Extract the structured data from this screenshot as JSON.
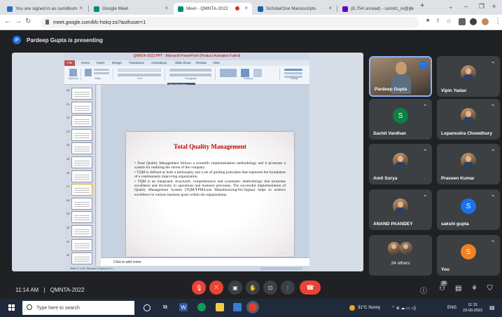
{
  "browser": {
    "tabs": [
      {
        "title": "You are signed in as sumitkum",
        "favicon_color": "#2b6ccd"
      },
      {
        "title": "Google Meet",
        "favicon_color": "#00897b"
      },
      {
        "title": "Meet - QMNTA-2022",
        "favicon_color": "#00897b"
      },
      {
        "title": "ScholarOne Manuscripts",
        "favicon_color": "#1a5fa8"
      },
      {
        "title": "(8,754 unread) - sumit1_in@ya",
        "favicon_color": "#6001d2"
      }
    ],
    "new_tab": "+",
    "close_glyph": "×",
    "address": "meet.google.com/kfc-hokq-zsi?authuser=1"
  },
  "meet": {
    "presenter_initial": "P",
    "presenter_text": "Pardeep Gupta is presenting",
    "meeting_time": "11:14 AM",
    "meeting_code": "QMNTA-2022",
    "separator": "|",
    "participants_badge": "34",
    "participants": [
      {
        "name": "Pardeep Gupta",
        "type": "video"
      },
      {
        "name": "Vipin Yadav",
        "type": "photo"
      },
      {
        "name": "Sachit Vardhan",
        "type": "letter",
        "letter": "S",
        "color": "#0b8043"
      },
      {
        "name": "Lopamudra Chowdhury",
        "type": "photo"
      },
      {
        "name": "Amit Surya",
        "type": "photo"
      },
      {
        "name": "Praveen Kumar",
        "type": "photo"
      },
      {
        "name": "ANAND PAANDEY",
        "type": "photo"
      },
      {
        "name": "sakshi gupta",
        "type": "letter",
        "letter": "S",
        "color": "#1a73e8"
      },
      {
        "name": "24 others",
        "type": "others"
      },
      {
        "name": "You",
        "type": "letter",
        "letter": "S",
        "color": "#f4811f"
      }
    ]
  },
  "ppt": {
    "window_title": "QMNTA-2022.PPT - Microsoft PowerPoint (Product Activation Failed)",
    "ribbon_tabs": [
      "File",
      "Home",
      "Insert",
      "Design",
      "Transitions",
      "Animations",
      "Slide Show",
      "Review",
      "View"
    ],
    "ribbon_groups": [
      "Clipboard",
      "Slides",
      "Font",
      "Paragraph",
      "Drawing",
      "Editing"
    ],
    "tooltip_title": "Start Slide Show",
    "tooltip_text": "Resume Slide Show",
    "slide_title": "Total Quality Management",
    "slide_bullets": [
      "• Total Quality Management follows a scientific implementation methodology and it promotes a system for realizing the vision of the company.",
      "• TQM is defined as both a philosophy and a set of guiding principles that represent the foundation of a continuously improving organization.",
      "• TQM is an integrated, structured, comprehensive and systematic methodology that promotes excellance and diversity in operations and business processes. The successful implementation of Quality Management System (TQM/TPM/Lean Manufacturing/Six-Sigma) helps to achieve excellence in various business goals within the organizations."
    ],
    "notes_placeholder": "Click to add notes",
    "status_text": "Slide 27 of 36   \"Standard\"   English (U.S.)",
    "thumb_numbers": [
      "20",
      "21",
      "22",
      "23",
      "24",
      "25",
      "26",
      "27",
      "28",
      "29",
      "30",
      "31",
      "32"
    ]
  },
  "taskbar": {
    "search_placeholder": "Type here to search",
    "weather": "31°C  Sunny",
    "lang": "ENG",
    "time": "11:15",
    "date": "23-03-2022"
  }
}
